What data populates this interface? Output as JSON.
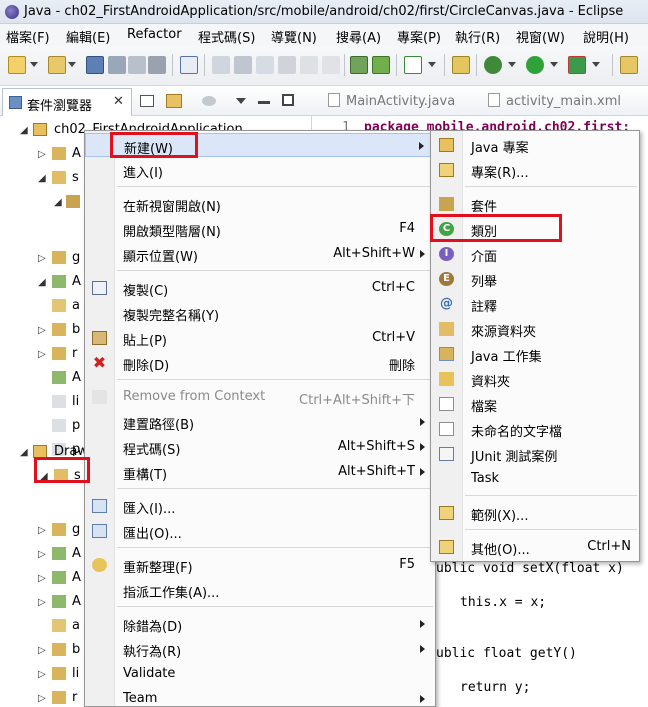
{
  "window": {
    "title": "Java - ch02_FirstAndroidApplication/src/mobile/android/ch02/first/CircleCanvas.java - Eclipse"
  },
  "menubar": [
    "檔案(F)",
    "編輯(E)",
    "Refactor",
    "程式碼(S)",
    "導覽(N)",
    "搜尋(A)",
    "專案(P)",
    "執行(R)",
    "視窗(W)",
    "說明(H)"
  ],
  "package_explorer": {
    "tab_label": "套件瀏覽器",
    "close_glyph": "✕",
    "project1": "ch02_FirstAndroidApplication",
    "project2": "Draw",
    "rows": [
      "A",
      "s",
      "g",
      "A",
      "a",
      "b",
      "r",
      "A",
      "li",
      "p",
      "p",
      "s",
      "g",
      "A",
      "A",
      "A",
      "a",
      "b",
      "li",
      "r"
    ]
  },
  "editor": {
    "tabs": [
      "MainActivity.java",
      "activity_main.xml"
    ],
    "line_number": "1",
    "code_line1": "package mobile.android.ch02.first;",
    "code_fragments": [
      "ublic void setX(float x)",
      "this.x = x;",
      "ublic float getY()",
      "return y;"
    ]
  },
  "context_menu": {
    "new": "新建(W)",
    "goto": "進入(I)",
    "open_new_window": "在新視窗開啟(N)",
    "open_type_hierarchy": "開啟類型階層(N)",
    "open_type_hierarchy_sc": "F4",
    "show_in": "顯示位置(W)",
    "show_in_sc": "Alt+Shift+W",
    "copy": "複製(C)",
    "copy_sc": "Ctrl+C",
    "copy_qualified": "複製完整名稱(Y)",
    "paste": "貼上(P)",
    "paste_sc": "Ctrl+V",
    "delete": "刪除(D)",
    "delete_sc": "刪除",
    "remove_context": "Remove from Context",
    "remove_context_sc": "Ctrl+Alt+Shift+下",
    "build_path": "建置路徑(B)",
    "source": "程式碼(S)",
    "source_sc": "Alt+Shift+S",
    "refactor": "重構(T)",
    "refactor_sc": "Alt+Shift+T",
    "import": "匯入(I)...",
    "export": "匯出(O)...",
    "refresh": "重新整理(F)",
    "refresh_sc": "F5",
    "assign_working_sets": "指派工作集(A)...",
    "debug_as": "除錯為(D)",
    "run_as": "執行為(R)",
    "validate": "Validate",
    "team": "Team"
  },
  "submenu": {
    "java_project": "Java 專案",
    "project": "專案(R)...",
    "package": "套件",
    "class": "類別",
    "interface": "介面",
    "enum": "列舉",
    "annotation": "註釋",
    "source_folder": "來源資料夾",
    "java_working_set": "Java 工作集",
    "folder": "資料夾",
    "file": "檔案",
    "untitled_text": "未命名的文字檔",
    "junit": "JUnit 測試案例",
    "task": "Task",
    "example": "範例(X)...",
    "other": "其他(O)...",
    "other_sc": "Ctrl+N"
  },
  "colors": {
    "highlight": "#e0101c",
    "keyword": "#7f0055",
    "menu_bg": "#fbfbfb"
  }
}
